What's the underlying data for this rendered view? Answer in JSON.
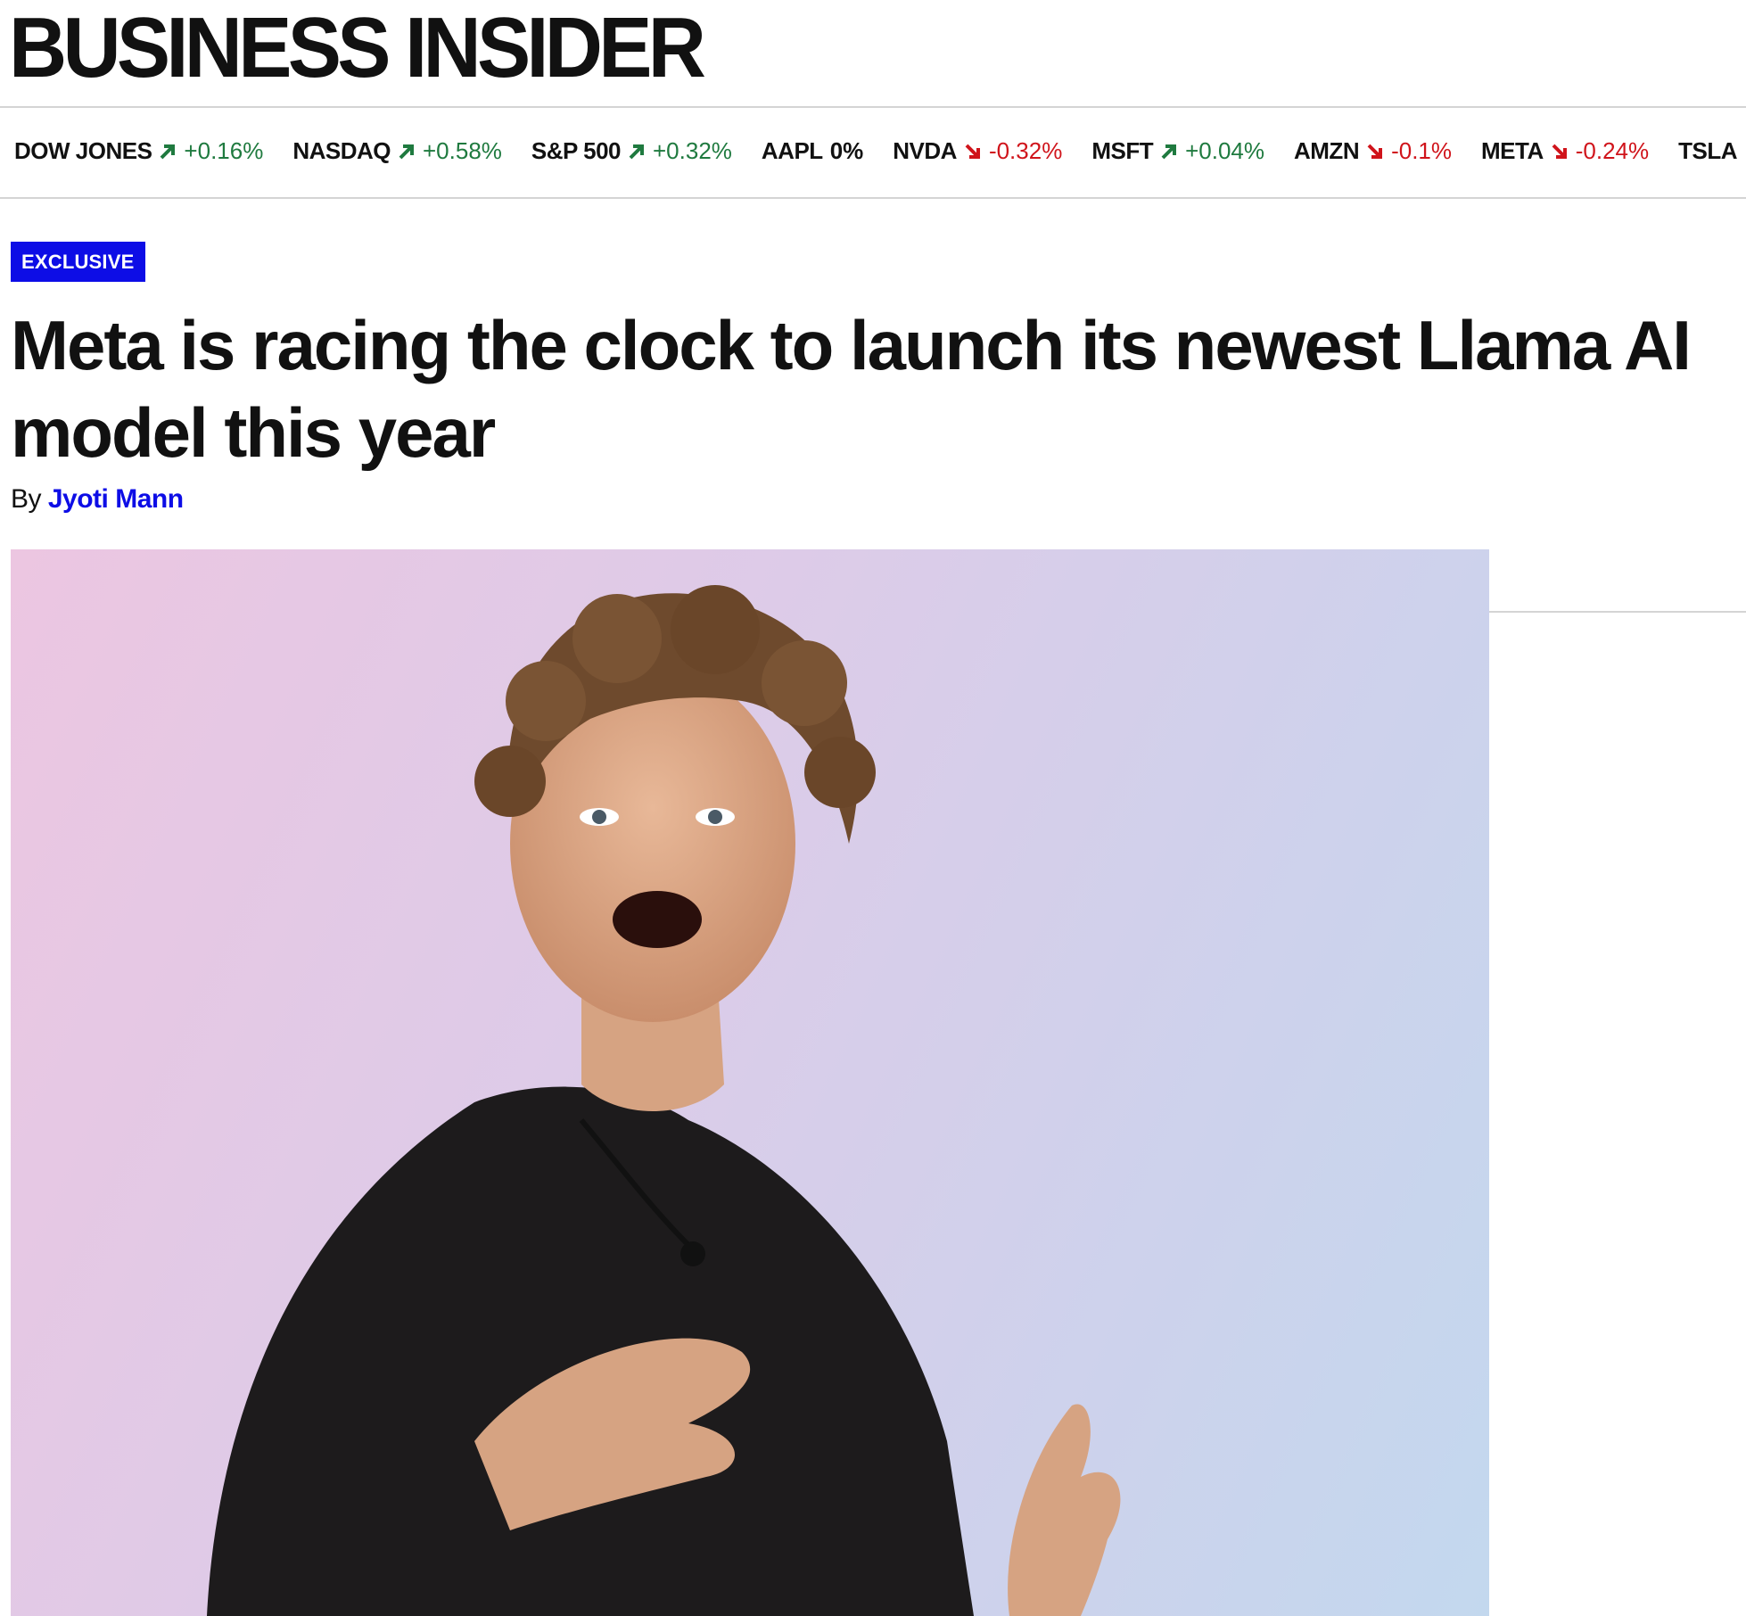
{
  "brand": {
    "logo_text": "BUSINESS INSIDER"
  },
  "ticker": [
    {
      "symbol": "DOW JONES",
      "direction": "up",
      "change": "+0.16%"
    },
    {
      "symbol": "NASDAQ",
      "direction": "up",
      "change": "+0.58%"
    },
    {
      "symbol": "S&P 500",
      "direction": "up",
      "change": "+0.32%"
    },
    {
      "symbol": "AAPL",
      "direction": "flat",
      "change": "0%"
    },
    {
      "symbol": "NVDA",
      "direction": "down",
      "change": "-0.32%"
    },
    {
      "symbol": "MSFT",
      "direction": "up",
      "change": "+0.04%"
    },
    {
      "symbol": "AMZN",
      "direction": "down",
      "change": "-0.1%"
    },
    {
      "symbol": "META",
      "direction": "down",
      "change": "-0.24%"
    },
    {
      "symbol": "TSLA",
      "direction": "",
      "change": ""
    }
  ],
  "colors": {
    "up": "#1f7a3f",
    "down": "#d0141b",
    "accent": "#0d0de6"
  },
  "article": {
    "badge": "EXCLUSIVE",
    "headline": "Meta is racing the clock to launch its newest Llama AI model this year",
    "byline_prefix": "By",
    "author": "Jyoti Mann"
  }
}
